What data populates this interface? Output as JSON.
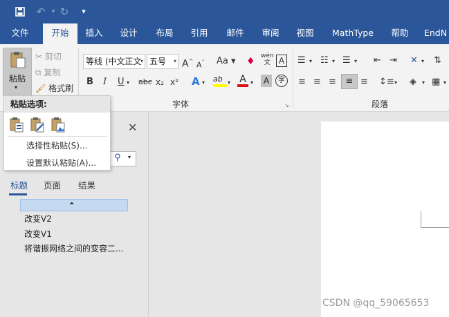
{
  "title_bar": {
    "save_icon": "save-icon",
    "undo_icon": "undo-icon",
    "redo_icon": "redo-icon",
    "customize_icon": "customize-quick-access-icon"
  },
  "tabs": [
    "文件",
    "开始",
    "插入",
    "设计",
    "布局",
    "引用",
    "邮件",
    "审阅",
    "视图",
    "MathType",
    "帮助",
    "EndN"
  ],
  "active_tab": "开始",
  "clipboard": {
    "paste_label_line1": "粘贴",
    "paste_label_line2": "粘贴",
    "cut_label": "剪切",
    "copy_label": "复制",
    "format_painter_label": "格式刷"
  },
  "font": {
    "font_name": "等线 (中文正文",
    "font_size": "五号",
    "group_label": "字体",
    "bold": "B",
    "italic": "I",
    "underline": "U",
    "strikethrough": "abc",
    "subscript": "x₂",
    "superscript": "x²",
    "change_case": "Aa",
    "grow_font": "A",
    "shrink_font": "A",
    "phonetic": "wén",
    "char_border": "A",
    "text_effect": "A",
    "highlight": "ab",
    "font_color": "A",
    "char_shading": "A",
    "enclose": "字"
  },
  "paragraph": {
    "group_label": "段落"
  },
  "paste_menu": {
    "header": "粘贴选项:",
    "paste_special": "选择性粘贴(S)...",
    "set_default_paste": "设置默认粘贴(A)..."
  },
  "nav_pane": {
    "close_icon": "close-icon",
    "search_icon": "search-icon",
    "tabs": [
      "标题",
      "页面",
      "结果"
    ],
    "active_tab": "标题",
    "items": [
      "改变V2",
      "改变V1",
      "将谐振网络之间的变容二..."
    ]
  },
  "watermark": "CSDN @qq_59065653",
  "colors": {
    "brand": "#2b579a",
    "ribbon_bg": "#f3f3f3",
    "workspace_bg": "#e6e6e6",
    "selected_heading": "#c5d9f1"
  }
}
